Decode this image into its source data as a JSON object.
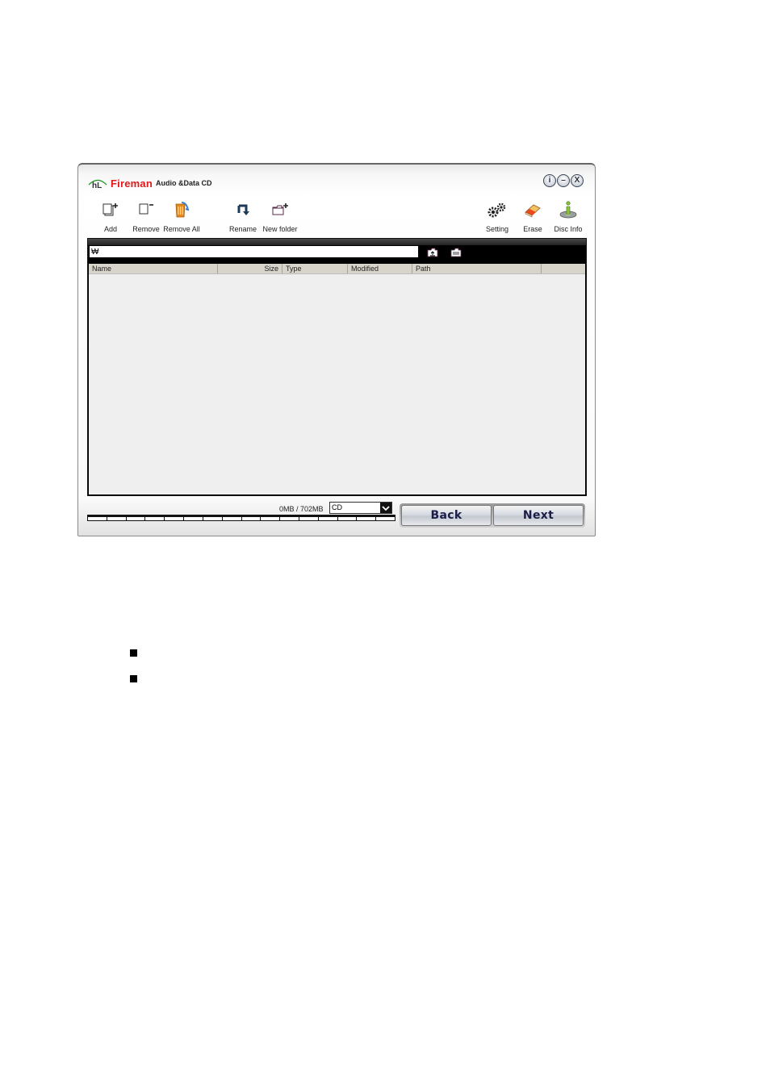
{
  "window": {
    "title_brand": "Fireman",
    "title_sub": "Audio &Data CD",
    "controls": [
      {
        "name": "info",
        "glyph": "i"
      },
      {
        "name": "minimize",
        "glyph": "–"
      },
      {
        "name": "close",
        "glyph": "X"
      }
    ]
  },
  "toolbar": {
    "add": "Add",
    "remove": "Remove",
    "remove_all": "Remove All",
    "rename": "Rename",
    "new_folder": "New folder",
    "setting": "Setting",
    "erase": "Erase",
    "disc_info": "Disc Info"
  },
  "path_bar": {
    "value": "₩",
    "up_folder_icon": "folder-up",
    "root_folder_icon": "folder-root"
  },
  "file_list": {
    "columns": [
      "Name",
      "Size",
      "Type",
      "Modified",
      "Path",
      ""
    ],
    "rows": []
  },
  "footer": {
    "capacity": "0MB / 702MB",
    "disc_type": "CD",
    "progress_percent": 0,
    "back_label": "Back",
    "next_label": "Next"
  },
  "colors": {
    "brand_red": "#e01a1a",
    "panel_black": "#000000",
    "list_bg": "#efefef",
    "header_bg": "#d8d4cc",
    "button_text": "#1c1c4a"
  },
  "bullets": [
    "",
    ""
  ]
}
